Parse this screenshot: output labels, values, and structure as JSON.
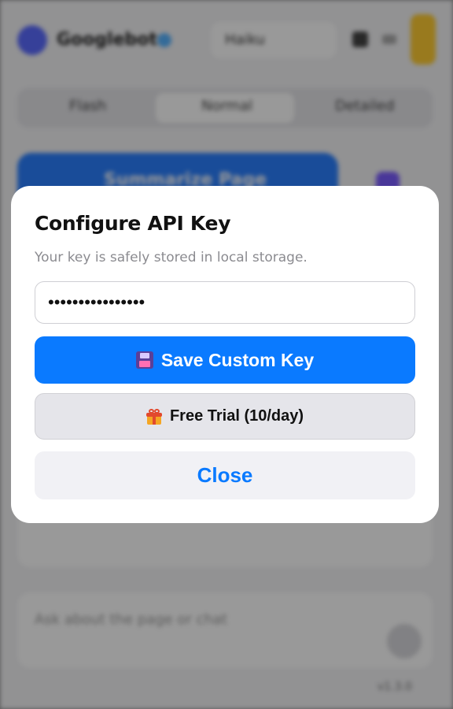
{
  "background": {
    "brand_name": "Googlebot",
    "model_selector": "Haiku",
    "tabs": [
      "Flash",
      "Normal",
      "Detailed"
    ],
    "primary_action": "Summarize Page",
    "chat_placeholder": "Ask about the page or chat",
    "footer_text": "v1.3.0"
  },
  "dialog": {
    "title": "Configure API Key",
    "subtitle": "Your key is safely stored in local storage.",
    "api_key_value": "••••••••••••••••",
    "save_label": "Save Custom Key",
    "trial_label": "Free Trial (10/day)",
    "close_label": "Close"
  },
  "icons": {
    "save": "floppy-disk-icon",
    "trial": "gift-icon"
  },
  "colors": {
    "accent": "#0a7aff",
    "overlay": "rgba(0,0,0,0.40)"
  }
}
